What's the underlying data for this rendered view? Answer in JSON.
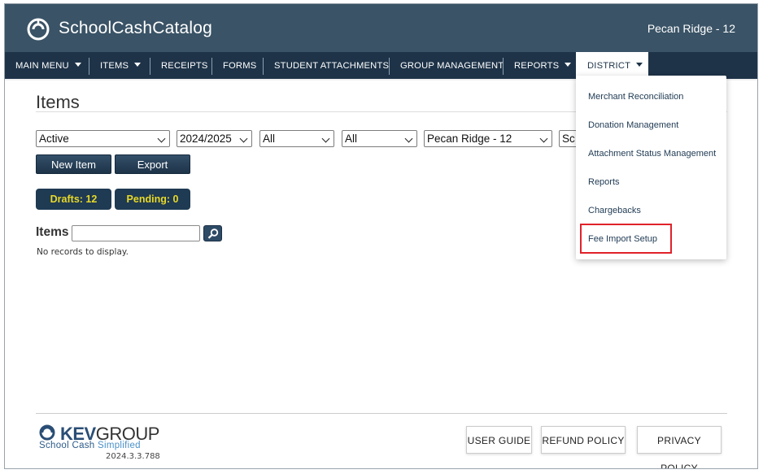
{
  "header": {
    "app_title": "SchoolCashCatalog",
    "school_name": "Pecan Ridge - 12"
  },
  "nav": {
    "items": [
      {
        "label": "MAIN MENU",
        "has_caret": true
      },
      {
        "label": "ITEMS",
        "has_caret": true
      },
      {
        "label": "RECEIPTS",
        "has_caret": false
      },
      {
        "label": "FORMS",
        "has_caret": false
      },
      {
        "label": "STUDENT ATTACHMENTS",
        "has_caret": false
      },
      {
        "label": "GROUP MANAGEMENT",
        "has_caret": false
      },
      {
        "label": "REPORTS",
        "has_caret": true
      },
      {
        "label": "DISTRICT",
        "has_caret": true
      }
    ],
    "active": "DISTRICT"
  },
  "main": {
    "page_title": "Items",
    "filters": [
      "Active",
      "2024/2025",
      "All",
      "All",
      "Pecan Ridge - 12",
      "Sc"
    ],
    "new_item_label": "New Item",
    "export_label": "Export",
    "drafts_label": "Drafts: 12",
    "pending_label": "Pending: 0",
    "items_label": "Items",
    "search_value": "",
    "no_records": "No records to display."
  },
  "district_menu": {
    "items": [
      "Merchant Reconciliation",
      "Donation Management",
      "Attachment Status Management",
      "Reports",
      "Chargebacks",
      "Fee Import Setup"
    ],
    "highlighted": "Fee Import Setup"
  },
  "footer": {
    "brand_kev": "KEV",
    "brand_group": "GROUP",
    "tagline_a": "School Cash ",
    "tagline_b": "Simplified",
    "version": "2024.3.3.788",
    "user_guide": "USER GUIDE",
    "refund_policy": "REFUND POLICY",
    "privacy_policy": "PRIVACY POLICY"
  },
  "colors": {
    "header_bg": "#3a5366",
    "nav_bg": "#1e3348",
    "pill_text": "#e8d928",
    "highlight": "#e0222a"
  }
}
